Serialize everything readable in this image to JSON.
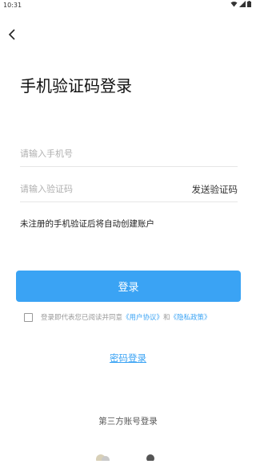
{
  "status_bar": {
    "time": "10:31"
  },
  "page": {
    "title": "手机验证码登录"
  },
  "form": {
    "phone_placeholder": "请输入手机号",
    "code_placeholder": "请输入验证码",
    "send_code_label": "发送验证码"
  },
  "hint": "未注册的手机验证后将自动创建账户",
  "login_button_label": "登录",
  "agreement": {
    "prefix": "登录即代表您已阅读并同意",
    "user_agreement": "《用户协议》",
    "and": "和",
    "privacy_policy": "《隐私政策》",
    "checked": false
  },
  "password_login_label": "密码登录",
  "third_party_label": "第三方账号登录",
  "colors": {
    "accent": "#3aa3f4"
  },
  "icons": [
    "wifi-icon",
    "signal-icon",
    "battery-icon",
    "back-arrow-icon",
    "third-party-login-icon"
  ]
}
